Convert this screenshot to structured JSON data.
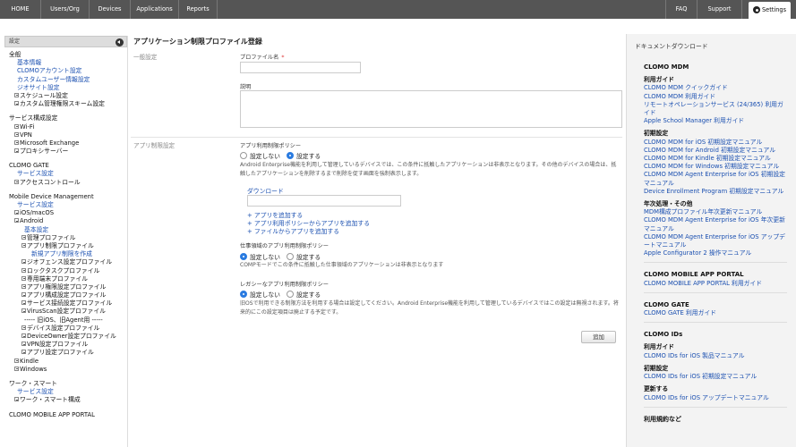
{
  "topnav": {
    "items": [
      "HOME",
      "Users/Org",
      "Devices",
      "Applications",
      "Reports"
    ],
    "right_items": [
      "FAQ",
      "Support"
    ],
    "settings_label": "Settings"
  },
  "sidebar": {
    "header": "設定",
    "tree": [
      {
        "text": "全般",
        "kind": "section",
        "indent": 0,
        "exp": false
      },
      {
        "text": "基本情報",
        "kind": "link",
        "indent": 1,
        "exp": false
      },
      {
        "text": "CLOMOアカウント設定",
        "kind": "link",
        "indent": 1,
        "exp": false
      },
      {
        "text": "カスタムユーザー情報設定",
        "kind": "link",
        "indent": 1,
        "exp": false
      },
      {
        "text": "ジオサイト設定",
        "kind": "link",
        "indent": 1,
        "exp": false
      },
      {
        "text": "スケジュール設定",
        "kind": "plain",
        "indent": 1,
        "exp": true
      },
      {
        "text": "カスタム管理権限スキーム設定",
        "kind": "plain",
        "indent": 1,
        "exp": true
      },
      {
        "text": "サービス構成設定",
        "kind": "section",
        "indent": 0,
        "exp": false
      },
      {
        "text": "Wi-Fi",
        "kind": "plain",
        "indent": 1,
        "exp": true
      },
      {
        "text": "VPN",
        "kind": "plain",
        "indent": 1,
        "exp": true
      },
      {
        "text": "Microsoft Exchange",
        "kind": "plain",
        "indent": 1,
        "exp": true
      },
      {
        "text": "プロキシサーバー",
        "kind": "plain",
        "indent": 1,
        "exp": true
      },
      {
        "text": "CLOMO GATE",
        "kind": "section",
        "indent": 0,
        "exp": false
      },
      {
        "text": "サービス設定",
        "kind": "link",
        "indent": 1,
        "exp": false
      },
      {
        "text": "アクセスコントロール",
        "kind": "plain",
        "indent": 1,
        "exp": true
      },
      {
        "text": "Mobile Device Management",
        "kind": "section",
        "indent": 0,
        "exp": false
      },
      {
        "text": "サービス設定",
        "kind": "link",
        "indent": 1,
        "exp": false
      },
      {
        "text": "iOS/macOS",
        "kind": "plain",
        "indent": 1,
        "exp": true
      },
      {
        "text": "Android",
        "kind": "plain",
        "indent": 1,
        "exp": true
      },
      {
        "text": "基本設定",
        "kind": "link",
        "indent": 2,
        "exp": false
      },
      {
        "text": "管理プロファイル",
        "kind": "plain",
        "indent": 2,
        "exp": true
      },
      {
        "text": "アプリ制限プロファイル",
        "kind": "plain",
        "indent": 2,
        "exp": true
      },
      {
        "text": "新規アプリ制限を作成",
        "kind": "link",
        "indent": 3,
        "exp": false
      },
      {
        "text": "ジオフェンス設定プロファイル",
        "kind": "plain",
        "indent": 2,
        "exp": true
      },
      {
        "text": "ロックタスクプロファイル",
        "kind": "plain",
        "indent": 2,
        "exp": true
      },
      {
        "text": "専用端末プロファイル",
        "kind": "plain",
        "indent": 2,
        "exp": true
      },
      {
        "text": "アプリ権限設定プロファイル",
        "kind": "plain",
        "indent": 2,
        "exp": true
      },
      {
        "text": "アプリ構成設定プロファイル",
        "kind": "plain",
        "indent": 2,
        "exp": true
      },
      {
        "text": "サービス接続設定プロファイル",
        "kind": "plain",
        "indent": 2,
        "exp": true
      },
      {
        "text": "VirusScan設定プロファイル",
        "kind": "plain",
        "indent": 2,
        "exp": true
      },
      {
        "text": "----- 旧iOS、旧Agent用 -----",
        "kind": "plain",
        "indent": 2,
        "exp": false
      },
      {
        "text": "デバイス設定プロファイル",
        "kind": "plain",
        "indent": 2,
        "exp": true
      },
      {
        "text": "DeviceOwner設定プロファイル",
        "kind": "plain",
        "indent": 2,
        "exp": true
      },
      {
        "text": "VPN設定プロファイル",
        "kind": "plain",
        "indent": 2,
        "exp": true
      },
      {
        "text": "アプリ設定プロファイル",
        "kind": "plain",
        "indent": 2,
        "exp": true
      },
      {
        "text": "Kindle",
        "kind": "plain",
        "indent": 1,
        "exp": true
      },
      {
        "text": "Windows",
        "kind": "plain",
        "indent": 1,
        "exp": true
      },
      {
        "text": "ワーク・スマート",
        "kind": "section",
        "indent": 0,
        "exp": false
      },
      {
        "text": "サービス設定",
        "kind": "link",
        "indent": 1,
        "exp": false
      },
      {
        "text": "ワーク・スマート構成",
        "kind": "plain",
        "indent": 1,
        "exp": true
      },
      {
        "text": "CLOMO MOBILE APP PORTAL",
        "kind": "section",
        "indent": 0,
        "exp": false
      }
    ]
  },
  "main": {
    "title": "アプリケーション制限プロファイル登録",
    "general_label": "一般設定",
    "profile_name_label": "プロファイル名",
    "required_mark": "*",
    "profile_name_value": "",
    "description_label": "説明",
    "description_value": "",
    "app_restriction_label": "アプリ制限設定",
    "app_policy_label": "アプリ利用制限ポリシー",
    "radio_off": "設定しない",
    "radio_on": "設定する",
    "app_policy_selected": "設定する",
    "app_policy_note": "Android Enterprise機能を利用して管理しているデバイスでは、この条件に抵触したアプリケーションは非表示となります。その他のデバイスの場合は、抵触したアプリケーションを削除するまで削除を促す画面を強制表示します。",
    "download_label": "ダウンロード",
    "download_value": "",
    "add_links": [
      "+ アプリを追加する",
      "+ アプリ利用ポリシーからアプリを追加する",
      "+ ファイルからアプリを追加する"
    ],
    "work_policy_label": "仕事領域のアプリ利用制限ポリシー",
    "work_policy_selected": "設定しない",
    "work_policy_note": "COMPモードでこの条件に抵触した仕事領域のアプリケーションは非表示となります",
    "legacy_policy_label": "レガシーなアプリ利用制限ポリシー",
    "legacy_policy_selected": "設定しない",
    "legacy_policy_note": "旧OSで利用できる制限方法を利用する場合は設定してください。Android Enterprise機能を利用して管理しているデバイスではこの設定は無視されます。将来的にこの設定項目は廃止する予定です。",
    "add_button": "追加"
  },
  "right_panel": {
    "title": "ドキュメントダウンロード",
    "entries": [
      {
        "t": "h",
        "group": true,
        "text": "CLOMO MDM"
      },
      {
        "t": "h",
        "group": false,
        "text": "利用ガイド"
      },
      {
        "t": "l",
        "text": "CLOMO MDM クイックガイド"
      },
      {
        "t": "l",
        "text": "CLOMO MDM 利用ガイド"
      },
      {
        "t": "l",
        "text": "リモートオペレーションサービス (24/365) 利用ガイド"
      },
      {
        "t": "l",
        "text": "Apple School Manager 利用ガイド"
      },
      {
        "t": "h",
        "group": false,
        "text": "初期設定"
      },
      {
        "t": "l",
        "text": "CLOMO MDM for iOS 初期設定マニュアル"
      },
      {
        "t": "l",
        "text": "CLOMO MDM for Android 初期設定マニュアル"
      },
      {
        "t": "l",
        "text": "CLOMO MDM for Kindle 初期設定マニュアル"
      },
      {
        "t": "l",
        "text": "CLOMO MDM for Windows 初期設定マニュアル"
      },
      {
        "t": "l",
        "text": "CLOMO MDM Agent Enterprise for iOS 初期設定マニュアル"
      },
      {
        "t": "l",
        "text": "Device Enrollment Program 初期設定マニュアル"
      },
      {
        "t": "h",
        "group": false,
        "text": "年次処理・その他"
      },
      {
        "t": "l",
        "text": "MDM構成プロファイル年次更新マニュアル"
      },
      {
        "t": "l",
        "text": "CLOMO MDM Agent Enterprise for iOS 年次更新マニュアル"
      },
      {
        "t": "l",
        "text": "CLOMO MDM Agent Enterprise for iOS アップデートマニュアル"
      },
      {
        "t": "l",
        "text": "Apple Configurator 2 操作マニュアル"
      },
      {
        "t": "sep"
      },
      {
        "t": "h",
        "group": true,
        "text": "CLOMO MOBILE APP PORTAL"
      },
      {
        "t": "l",
        "text": "CLOMO MOBILE APP PORTAL 利用ガイド"
      },
      {
        "t": "sep"
      },
      {
        "t": "h",
        "group": true,
        "text": "CLOMO GATE"
      },
      {
        "t": "l",
        "text": "CLOMO GATE 利用ガイド"
      },
      {
        "t": "sep"
      },
      {
        "t": "h",
        "group": true,
        "text": "CLOMO IDs"
      },
      {
        "t": "h",
        "group": false,
        "text": "利用ガイド"
      },
      {
        "t": "l",
        "text": "CLOMO IDs for iOS 製品マニュアル"
      },
      {
        "t": "h",
        "group": false,
        "text": "初期設定"
      },
      {
        "t": "l",
        "text": "CLOMO IDs for iOS 初期設定マニュアル"
      },
      {
        "t": "h",
        "group": false,
        "text": "更新する"
      },
      {
        "t": "l",
        "text": "CLOMO IDs for iOS アップデートマニュアル"
      },
      {
        "t": "sep"
      },
      {
        "t": "h",
        "group": true,
        "text": "利用規約など"
      }
    ]
  }
}
